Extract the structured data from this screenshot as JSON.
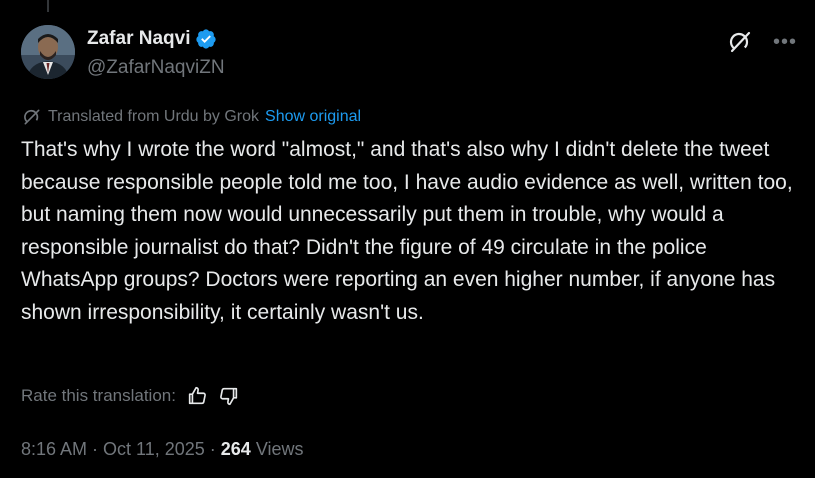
{
  "author": {
    "name": "Zafar Naqvi",
    "handle": "@ZafarNaqviZN",
    "verified": true
  },
  "icons": {
    "grok": "grok-icon",
    "more": "more-icon",
    "thumbs_up": "thumbs-up-icon",
    "thumbs_down": "thumbs-down-icon"
  },
  "translation": {
    "notice": "Translated from Urdu by Grok",
    "show_original": "Show original",
    "rate_label": "Rate this translation:"
  },
  "tweet": {
    "text": "That's why I wrote the word \"almost,\" and that's also why I didn't delete the tweet because responsible people told me too, I have audio evidence as well, written too, but naming them now would unnecessarily put them in trouble, why would a responsible journalist do that? Didn't the figure of 49 circulate in the police WhatsApp groups? Doctors were reporting an even higher number, if anyone has shown irresponsibility, it certainly wasn't us.",
    "time": "8:16 AM",
    "date": "Oct 11, 2025",
    "views_count": "264",
    "views_label": "Views",
    "separator": "·"
  },
  "colors": {
    "background": "#000000",
    "text": "#e7e9ea",
    "muted": "#71767b",
    "accent": "#1d9bf0"
  }
}
